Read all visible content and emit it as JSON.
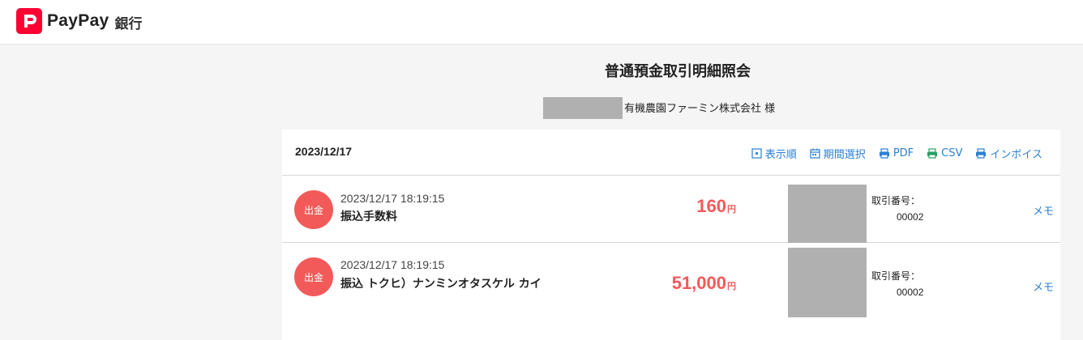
{
  "header": {
    "logo_text": "PayPay",
    "logo_bank": "銀行"
  },
  "page": {
    "title": "普通預金取引明細照会",
    "customer_name": "有機農園ファーミン株式会社 様"
  },
  "panel": {
    "date": "2023/12/17",
    "tools": [
      {
        "label": "表示順",
        "icon": "sort-icon"
      },
      {
        "label": "期間選択",
        "icon": "calendar-icon"
      },
      {
        "label": "PDF",
        "icon": "printer-icon"
      },
      {
        "label": "CSV",
        "icon": "csv-icon"
      },
      {
        "label": "インボイス",
        "icon": "printer-icon"
      }
    ]
  },
  "transactions": [
    {
      "type": "出金",
      "datetime": "2023/12/17 18:19:15",
      "description": "振込手数料",
      "amount": "160",
      "currency": "円",
      "ref_label": "取引番号：",
      "ref_value": "00002",
      "memo": "メモ"
    },
    {
      "type": "出金",
      "datetime": "2023/12/17 18:19:15",
      "description": "振込 トクヒ）ナンミンオタスケル カイ",
      "amount": "51,000",
      "currency": "円",
      "ref_label": "取引番号：",
      "ref_value": "00002",
      "memo": "メモ"
    }
  ],
  "colors": {
    "brand_red": "#ff0033",
    "withdrawal": "#f25a5a",
    "link": "#2a7fd4"
  }
}
